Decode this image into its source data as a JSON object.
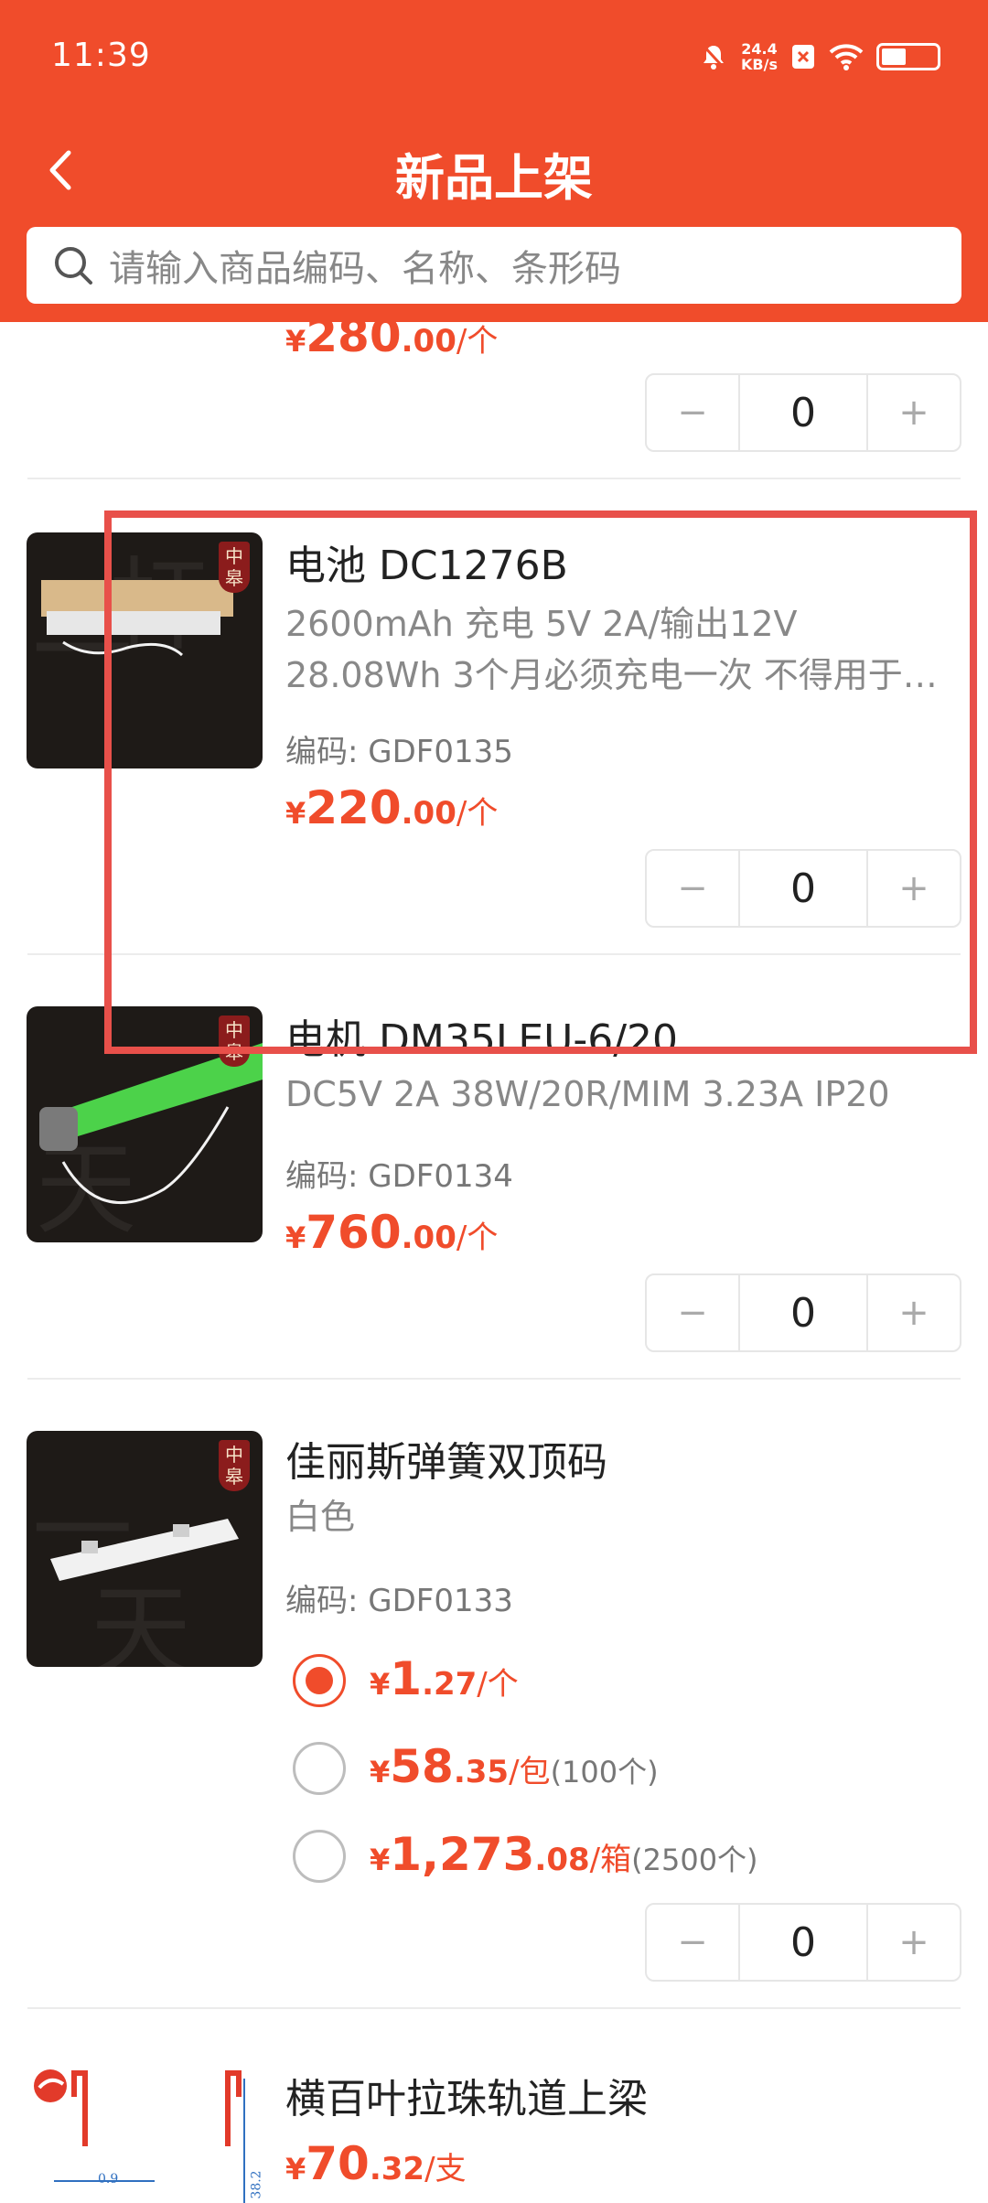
{
  "status_bar": {
    "time": "11:39",
    "net_speed_value": "24.4",
    "net_speed_unit": "KB/s"
  },
  "nav": {
    "title": "新品上架"
  },
  "search": {
    "placeholder": "请输入商品编码、名称、条形码"
  },
  "colors": {
    "brand": "#f04c2b",
    "highlight": "#e8504a"
  },
  "currency_symbol": "¥",
  "code_label": "编码: ",
  "items": [
    {
      "price": {
        "int": "280",
        "dec": ".00",
        "unit": "/个"
      },
      "quantity": "0"
    },
    {
      "name": "电池 DC1276B",
      "desc": "2600mAh 充电 5V 2A/输出12V 28.08Wh 3个月必须充电一次 不得用于天棚帘、超大窗帘",
      "code": "GDF0135",
      "price": {
        "int": "220",
        "dec": ".00",
        "unit": "/个"
      },
      "quantity": "0"
    },
    {
      "name": "电机 DM35LEU-6/20",
      "desc": "DC5V 2A 38W/20R/MIM 3.23A IP20",
      "code": "GDF0134",
      "price": {
        "int": "760",
        "dec": ".00",
        "unit": "/个"
      },
      "quantity": "0"
    },
    {
      "name": "佳丽斯弹簧双顶码",
      "desc": "白色",
      "code": "GDF0133",
      "options": [
        {
          "int": "1",
          "dec": ".27",
          "unit": "/个",
          "note": "",
          "selected": true
        },
        {
          "int": "58",
          "dec": ".35",
          "unit": "/包",
          "note": "(100个)",
          "selected": false
        },
        {
          "int": "1,273",
          "dec": ".08",
          "unit": "/箱",
          "note": "(2500个)",
          "selected": false
        }
      ],
      "quantity": "0"
    },
    {
      "name": "横百叶拉珠轨道上梁",
      "price": {
        "int": "70",
        "dec": ".32",
        "unit": "/支"
      },
      "drawing_dims": [
        "0.9",
        "38.2"
      ]
    }
  ]
}
